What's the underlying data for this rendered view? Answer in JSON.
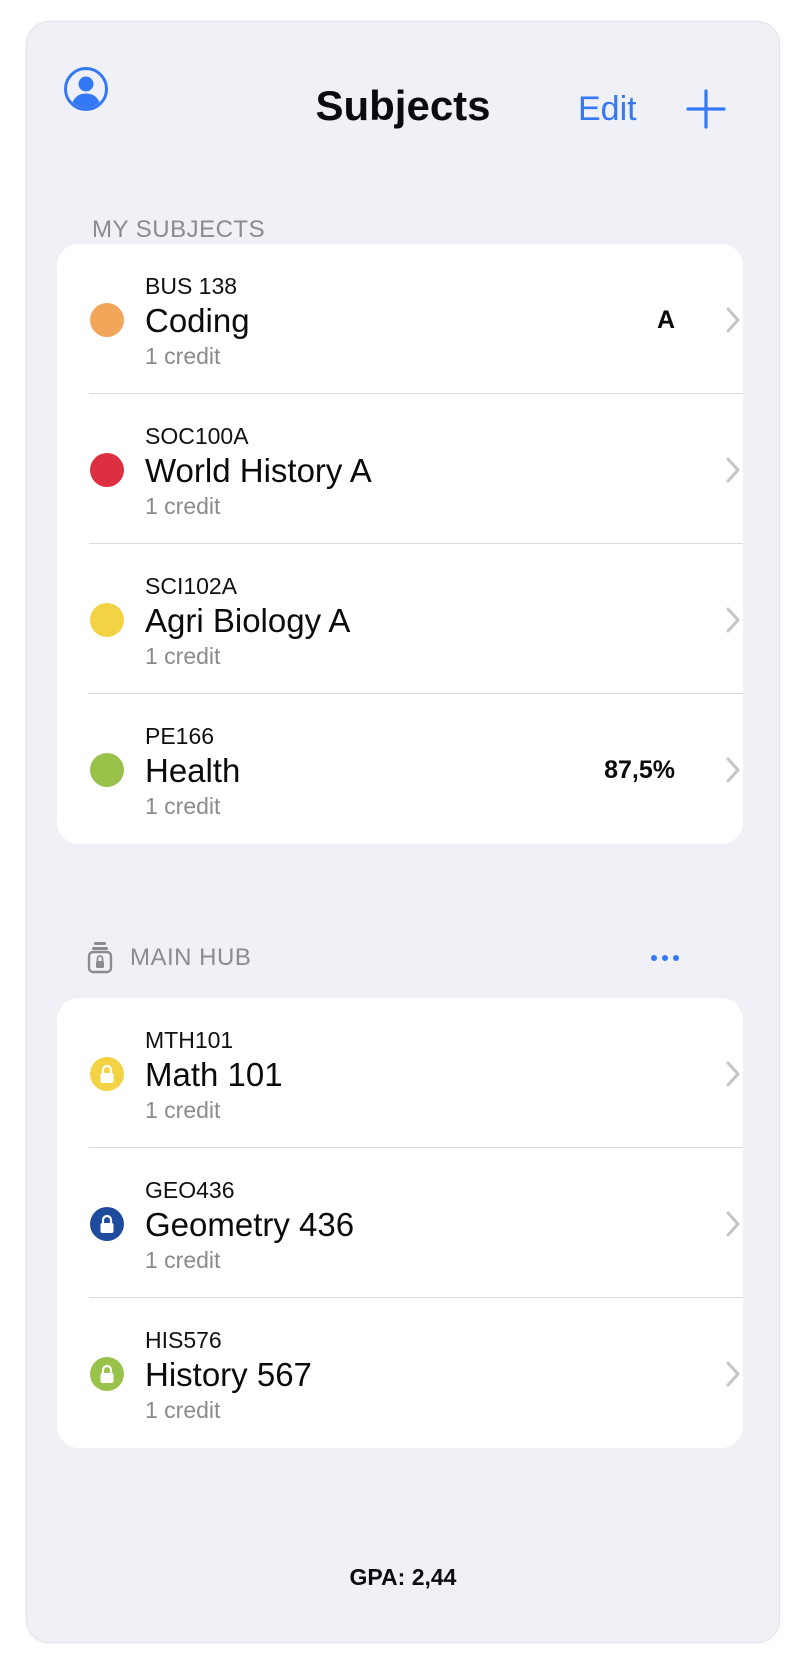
{
  "header": {
    "title": "Subjects",
    "edit_label": "Edit",
    "profile_icon": "person-circle-icon",
    "add_icon": "plus-icon"
  },
  "colors": {
    "accent": "#3478f6",
    "background": "#f0f1f6"
  },
  "my_subjects": {
    "header": "MY SUBJECTS",
    "items": [
      {
        "code": "BUS 138",
        "name": "Coding",
        "credit": "1 credit",
        "grade": "A",
        "color": "#f2a65a"
      },
      {
        "code": "SOC100A",
        "name": "World History A",
        "credit": "1 credit",
        "grade": "",
        "color": "#dc3040"
      },
      {
        "code": "SCI102A",
        "name": "Agri Biology A",
        "credit": "1 credit",
        "grade": "",
        "color": "#f3d244"
      },
      {
        "code": "PE166",
        "name": "Health",
        "credit": "1 credit",
        "grade": "87,5%",
        "color": "#98c24a"
      }
    ]
  },
  "main_hub": {
    "header": "MAIN HUB",
    "header_icon": "locked-archive-icon",
    "more_icon": "ellipsis-icon",
    "items": [
      {
        "code": "MTH101",
        "name": "Math 101",
        "credit": "1 credit",
        "color": "#f3d244",
        "icon": "lock-icon"
      },
      {
        "code": "GEO436",
        "name": "Geometry 436",
        "credit": "1 credit",
        "color": "#1e4b9e",
        "icon": "lock-icon"
      },
      {
        "code": "HIS576",
        "name": "History 567",
        "credit": "1 credit",
        "color": "#98c24a",
        "icon": "lock-icon"
      }
    ]
  },
  "footer": {
    "gpa": "GPA: 2,44"
  }
}
